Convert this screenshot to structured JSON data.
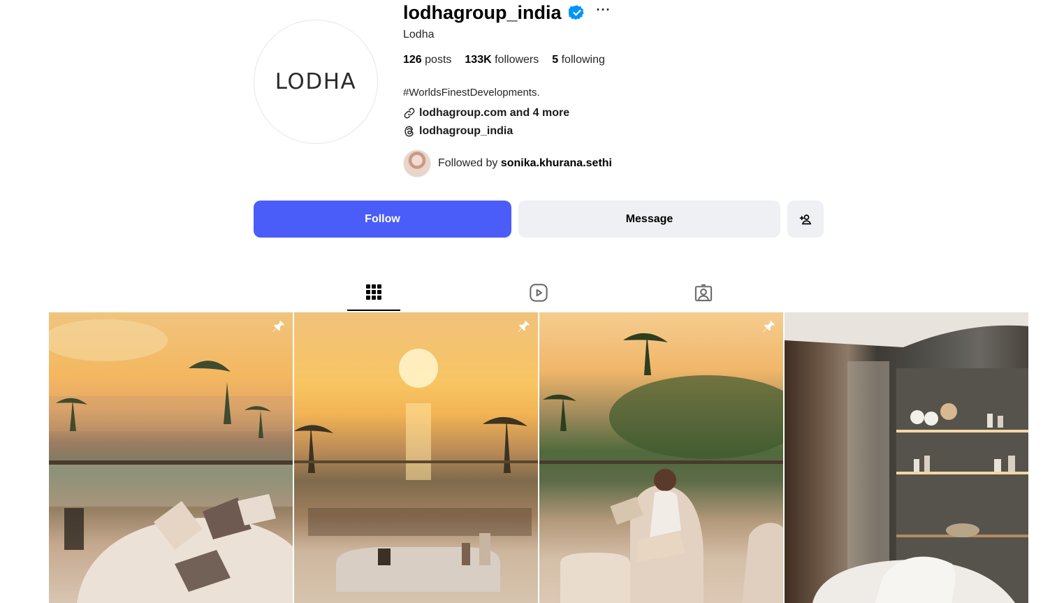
{
  "profile": {
    "username": "lodhagroup_india",
    "full_name": "Lodha",
    "avatar_logo_text": "LODHA",
    "verified_icon": "verified-badge-icon",
    "verified_color": "#0095f6",
    "stats": {
      "posts_count": "126",
      "posts_label": "posts",
      "followers_count": "133K",
      "followers_label": "followers",
      "following_count": "5",
      "following_label": "following"
    },
    "bio": "#WorldsFinestDevelopments.",
    "link_text": "lodhagroup.com and 4 more",
    "threads_handle": "lodhagroup_india",
    "followed_by_prefix": "Followed by",
    "followed_by_user": "sonika.khurana.sethi"
  },
  "actions": {
    "follow_label": "Follow",
    "message_label": "Message",
    "follow_color": "#4a5df9"
  },
  "tabs": [
    {
      "name": "posts",
      "icon": "grid-icon",
      "active": true
    },
    {
      "name": "reels",
      "icon": "reels-icon",
      "active": false
    },
    {
      "name": "tagged",
      "icon": "tagged-icon",
      "active": false
    }
  ],
  "posts": [
    {
      "pinned": true,
      "icon": "pin-icon"
    },
    {
      "pinned": true,
      "icon": "pin-icon"
    },
    {
      "pinned": true,
      "icon": "pin-icon"
    },
    {
      "pinned": false
    }
  ]
}
